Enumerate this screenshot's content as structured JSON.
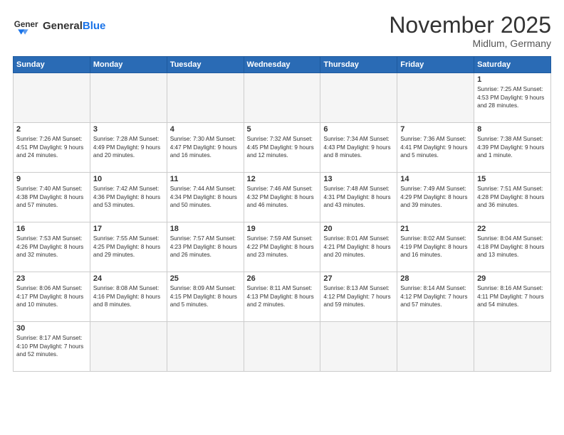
{
  "logo": {
    "text_general": "General",
    "text_blue": "Blue"
  },
  "title": "November 2025",
  "subtitle": "Midlum, Germany",
  "weekdays": [
    "Sunday",
    "Monday",
    "Tuesday",
    "Wednesday",
    "Thursday",
    "Friday",
    "Saturday"
  ],
  "weeks": [
    [
      {
        "day": "",
        "info": ""
      },
      {
        "day": "",
        "info": ""
      },
      {
        "day": "",
        "info": ""
      },
      {
        "day": "",
        "info": ""
      },
      {
        "day": "",
        "info": ""
      },
      {
        "day": "",
        "info": ""
      },
      {
        "day": "1",
        "info": "Sunrise: 7:25 AM\nSunset: 4:53 PM\nDaylight: 9 hours\nand 28 minutes."
      }
    ],
    [
      {
        "day": "2",
        "info": "Sunrise: 7:26 AM\nSunset: 4:51 PM\nDaylight: 9 hours\nand 24 minutes."
      },
      {
        "day": "3",
        "info": "Sunrise: 7:28 AM\nSunset: 4:49 PM\nDaylight: 9 hours\nand 20 minutes."
      },
      {
        "day": "4",
        "info": "Sunrise: 7:30 AM\nSunset: 4:47 PM\nDaylight: 9 hours\nand 16 minutes."
      },
      {
        "day": "5",
        "info": "Sunrise: 7:32 AM\nSunset: 4:45 PM\nDaylight: 9 hours\nand 12 minutes."
      },
      {
        "day": "6",
        "info": "Sunrise: 7:34 AM\nSunset: 4:43 PM\nDaylight: 9 hours\nand 8 minutes."
      },
      {
        "day": "7",
        "info": "Sunrise: 7:36 AM\nSunset: 4:41 PM\nDaylight: 9 hours\nand 5 minutes."
      },
      {
        "day": "8",
        "info": "Sunrise: 7:38 AM\nSunset: 4:39 PM\nDaylight: 9 hours\nand 1 minute."
      }
    ],
    [
      {
        "day": "9",
        "info": "Sunrise: 7:40 AM\nSunset: 4:38 PM\nDaylight: 8 hours\nand 57 minutes."
      },
      {
        "day": "10",
        "info": "Sunrise: 7:42 AM\nSunset: 4:36 PM\nDaylight: 8 hours\nand 53 minutes."
      },
      {
        "day": "11",
        "info": "Sunrise: 7:44 AM\nSunset: 4:34 PM\nDaylight: 8 hours\nand 50 minutes."
      },
      {
        "day": "12",
        "info": "Sunrise: 7:46 AM\nSunset: 4:32 PM\nDaylight: 8 hours\nand 46 minutes."
      },
      {
        "day": "13",
        "info": "Sunrise: 7:48 AM\nSunset: 4:31 PM\nDaylight: 8 hours\nand 43 minutes."
      },
      {
        "day": "14",
        "info": "Sunrise: 7:49 AM\nSunset: 4:29 PM\nDaylight: 8 hours\nand 39 minutes."
      },
      {
        "day": "15",
        "info": "Sunrise: 7:51 AM\nSunset: 4:28 PM\nDaylight: 8 hours\nand 36 minutes."
      }
    ],
    [
      {
        "day": "16",
        "info": "Sunrise: 7:53 AM\nSunset: 4:26 PM\nDaylight: 8 hours\nand 32 minutes."
      },
      {
        "day": "17",
        "info": "Sunrise: 7:55 AM\nSunset: 4:25 PM\nDaylight: 8 hours\nand 29 minutes."
      },
      {
        "day": "18",
        "info": "Sunrise: 7:57 AM\nSunset: 4:23 PM\nDaylight: 8 hours\nand 26 minutes."
      },
      {
        "day": "19",
        "info": "Sunrise: 7:59 AM\nSunset: 4:22 PM\nDaylight: 8 hours\nand 23 minutes."
      },
      {
        "day": "20",
        "info": "Sunrise: 8:01 AM\nSunset: 4:21 PM\nDaylight: 8 hours\nand 20 minutes."
      },
      {
        "day": "21",
        "info": "Sunrise: 8:02 AM\nSunset: 4:19 PM\nDaylight: 8 hours\nand 16 minutes."
      },
      {
        "day": "22",
        "info": "Sunrise: 8:04 AM\nSunset: 4:18 PM\nDaylight: 8 hours\nand 13 minutes."
      }
    ],
    [
      {
        "day": "23",
        "info": "Sunrise: 8:06 AM\nSunset: 4:17 PM\nDaylight: 8 hours\nand 10 minutes."
      },
      {
        "day": "24",
        "info": "Sunrise: 8:08 AM\nSunset: 4:16 PM\nDaylight: 8 hours\nand 8 minutes."
      },
      {
        "day": "25",
        "info": "Sunrise: 8:09 AM\nSunset: 4:15 PM\nDaylight: 8 hours\nand 5 minutes."
      },
      {
        "day": "26",
        "info": "Sunrise: 8:11 AM\nSunset: 4:13 PM\nDaylight: 8 hours\nand 2 minutes."
      },
      {
        "day": "27",
        "info": "Sunrise: 8:13 AM\nSunset: 4:12 PM\nDaylight: 7 hours\nand 59 minutes."
      },
      {
        "day": "28",
        "info": "Sunrise: 8:14 AM\nSunset: 4:12 PM\nDaylight: 7 hours\nand 57 minutes."
      },
      {
        "day": "29",
        "info": "Sunrise: 8:16 AM\nSunset: 4:11 PM\nDaylight: 7 hours\nand 54 minutes."
      }
    ],
    [
      {
        "day": "30",
        "info": "Sunrise: 8:17 AM\nSunset: 4:10 PM\nDaylight: 7 hours\nand 52 minutes."
      },
      {
        "day": "",
        "info": ""
      },
      {
        "day": "",
        "info": ""
      },
      {
        "day": "",
        "info": ""
      },
      {
        "day": "",
        "info": ""
      },
      {
        "day": "",
        "info": ""
      },
      {
        "day": "",
        "info": ""
      }
    ]
  ]
}
